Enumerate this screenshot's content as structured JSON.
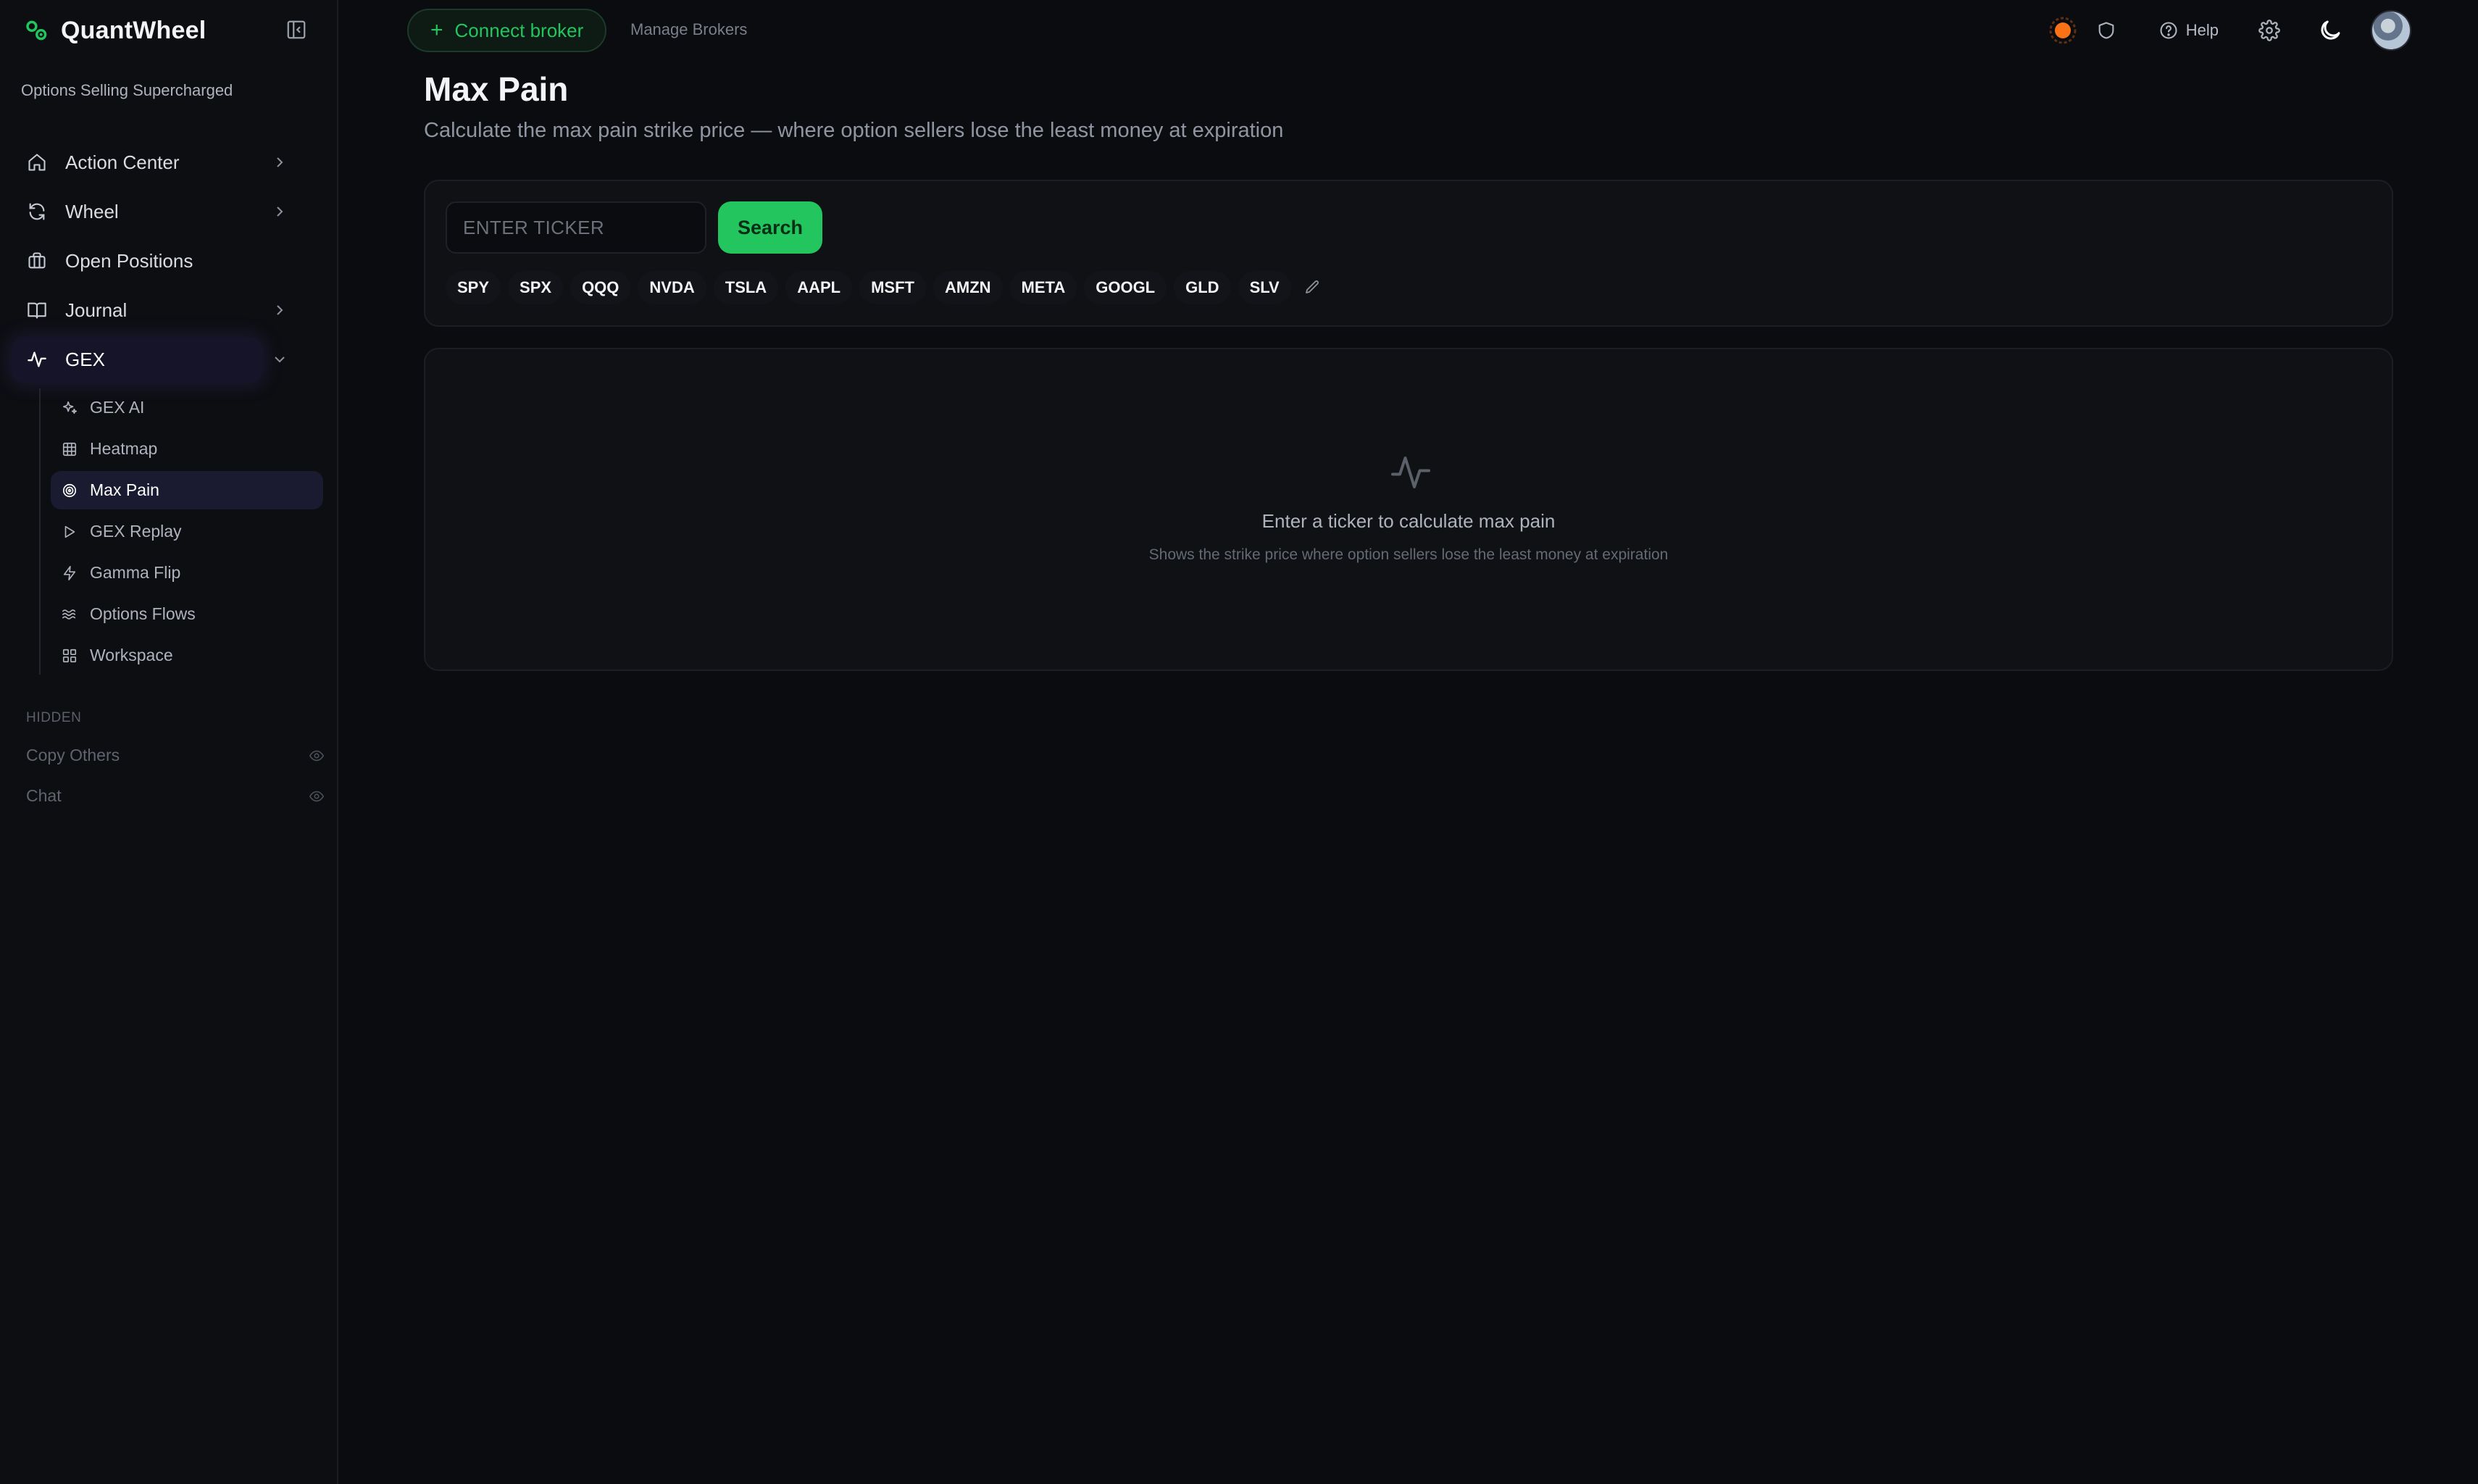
{
  "app": {
    "name": "QuantWheel",
    "tagline": "Options Selling Supercharged"
  },
  "sidebar": {
    "items": [
      {
        "label": "Action Center",
        "icon": "home-icon",
        "has_chevron": true
      },
      {
        "label": "Wheel",
        "icon": "refresh-icon",
        "has_chevron": true
      },
      {
        "label": "Open Positions",
        "icon": "briefcase-icon",
        "has_chevron": false
      },
      {
        "label": "Journal",
        "icon": "book-icon",
        "has_chevron": true
      },
      {
        "label": "GEX",
        "icon": "activity-icon",
        "has_chevron": true,
        "expanded": true,
        "active": true
      }
    ],
    "gex_subitems": [
      {
        "label": "GEX AI",
        "icon": "sparkles-icon"
      },
      {
        "label": "Heatmap",
        "icon": "grid-icon"
      },
      {
        "label": "Max Pain",
        "icon": "target-icon",
        "active": true
      },
      {
        "label": "GEX Replay",
        "icon": "play-icon"
      },
      {
        "label": "Gamma Flip",
        "icon": "zap-icon"
      },
      {
        "label": "Options Flows",
        "icon": "waves-icon"
      },
      {
        "label": "Workspace",
        "icon": "layout-grid-icon"
      }
    ],
    "hidden_title": "HIDDEN",
    "hidden_items": [
      {
        "label": "Copy Others",
        "icon": "eye-icon"
      },
      {
        "label": "Chat",
        "icon": "eye-icon"
      }
    ]
  },
  "topbar": {
    "connect_label": "Connect broker",
    "manage_label": "Manage Brokers",
    "help_label": "Help"
  },
  "page": {
    "title": "Max Pain",
    "subtitle": "Calculate the max pain strike price — where option sellers lose the least money at expiration"
  },
  "search": {
    "placeholder": "ENTER TICKER",
    "value": "",
    "button_label": "Search",
    "tickers": [
      "SPY",
      "SPX",
      "QQQ",
      "NVDA",
      "TSLA",
      "AAPL",
      "MSFT",
      "AMZN",
      "META",
      "GOOGL",
      "GLD",
      "SLV"
    ]
  },
  "empty_state": {
    "title": "Enter a ticker to calculate max pain",
    "description": "Shows the strike price where option sellers lose the least money at expiration"
  },
  "colors": {
    "accent": "#22c55e",
    "status_dot": "#f97316",
    "background": "#0b0c10",
    "card": "#0f1115",
    "active_nav": "#1a1a30"
  }
}
